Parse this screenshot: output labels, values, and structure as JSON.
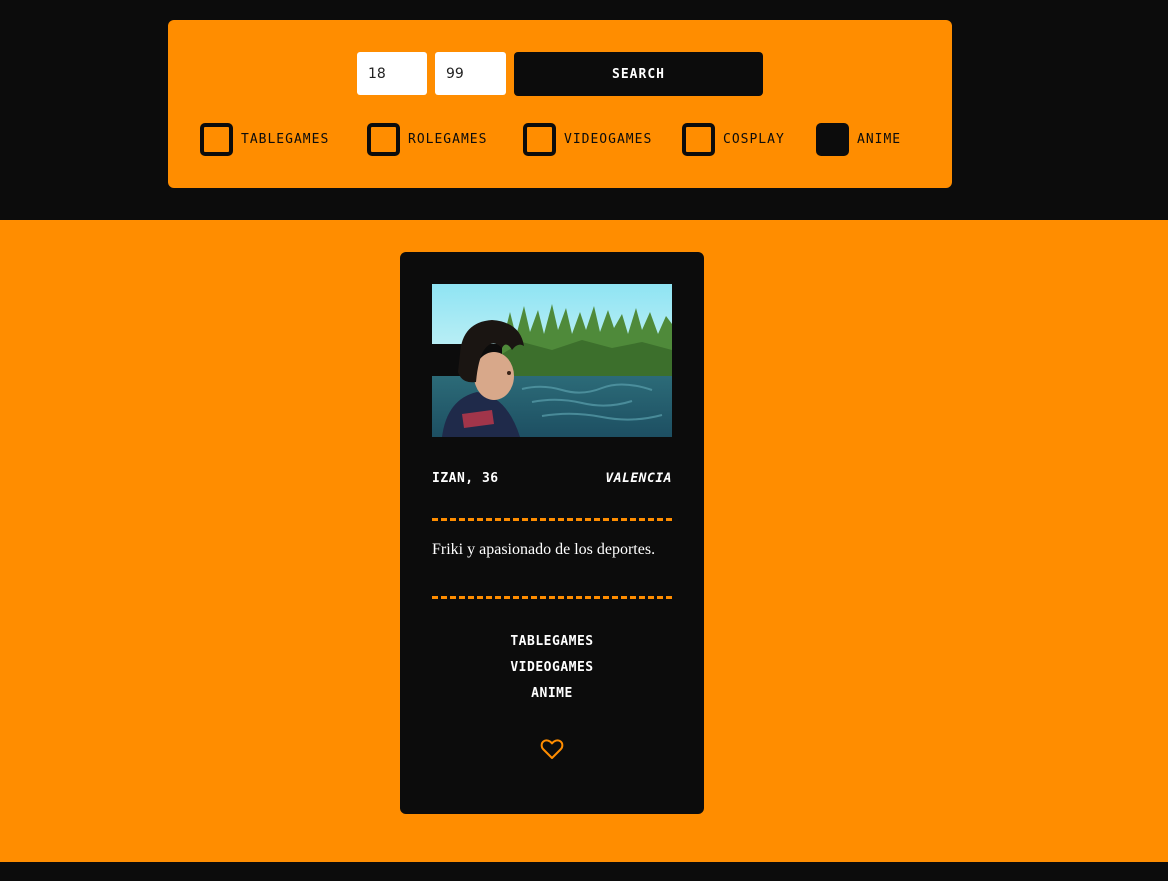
{
  "filters": {
    "age_min": "18",
    "age_max": "99",
    "search_label": "Search",
    "categories": [
      {
        "label": "Tablegames",
        "checked": false
      },
      {
        "label": "Rolegames",
        "checked": false
      },
      {
        "label": "Videogames",
        "checked": false
      },
      {
        "label": "Cosplay",
        "checked": false
      },
      {
        "label": "Anime",
        "checked": true
      }
    ]
  },
  "profile": {
    "name_age": "Izan, 36",
    "location": "Valencia",
    "bio": "Friki y apasionado de los deportes.",
    "interests": [
      "Tablegames",
      "Videogames",
      "Anime"
    ],
    "like_icon": "heart-icon"
  },
  "colors": {
    "accent": "#ff8d00",
    "dark": "#0c0c0c",
    "text_light": "#ffffff"
  }
}
